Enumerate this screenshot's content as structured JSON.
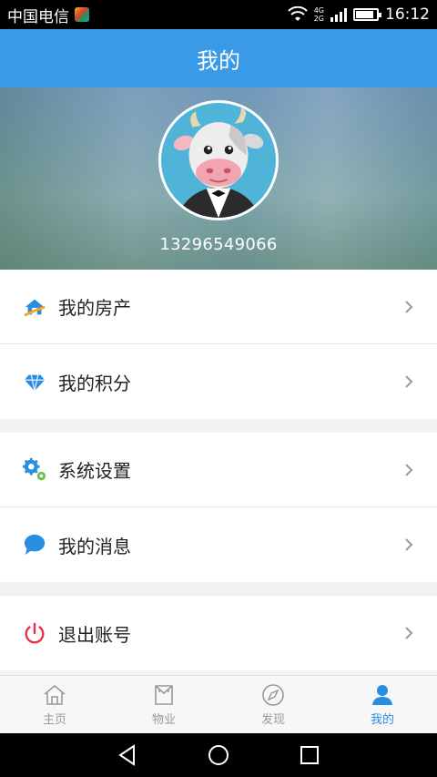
{
  "status_bar": {
    "carrier": "中国电信",
    "network_top": "4G",
    "network_bottom": "2G",
    "time": "16:12",
    "battery_level": 0.85
  },
  "header": {
    "title": "我的"
  },
  "profile": {
    "phone": "13296549066"
  },
  "menu": {
    "group1": [
      {
        "label": "我的房产",
        "icon": "house-icon"
      },
      {
        "label": "我的积分",
        "icon": "diamond-icon"
      }
    ],
    "group2": [
      {
        "label": "系统设置",
        "icon": "gears-icon"
      },
      {
        "label": "我的消息",
        "icon": "chat-bubble-icon"
      }
    ],
    "group3": [
      {
        "label": "退出账号",
        "icon": "power-icon"
      }
    ]
  },
  "tabs": [
    {
      "label": "主页",
      "icon": "home-icon",
      "active": false
    },
    {
      "label": "物业",
      "icon": "property-icon",
      "active": false
    },
    {
      "label": "发现",
      "icon": "compass-icon",
      "active": false
    },
    {
      "label": "我的",
      "icon": "user-icon",
      "active": true
    }
  ],
  "colors": {
    "header_blue": "#3a9ae8",
    "active_tab": "#2a8ee0",
    "logout_red": "#e8314c"
  }
}
